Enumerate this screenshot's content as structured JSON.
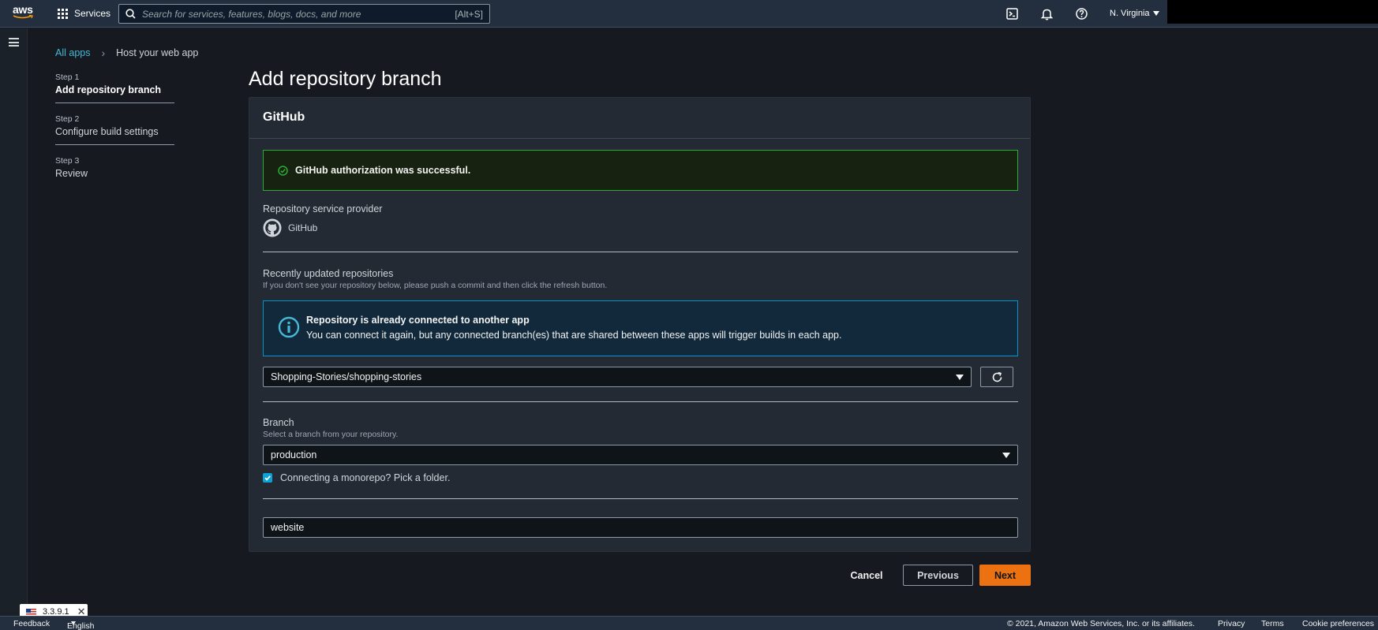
{
  "topnav": {
    "logo_text": "aws",
    "services_label": "Services",
    "search_placeholder": "Search for services, features, blogs, docs, and more",
    "search_shortcut": "[Alt+S]",
    "region": "N. Virginia"
  },
  "breadcrumb": {
    "root": "All apps",
    "current": "Host your web app"
  },
  "steps": [
    {
      "num": "Step 1",
      "title": "Add repository branch",
      "active": true
    },
    {
      "num": "Step 2",
      "title": "Configure build settings",
      "active": false
    },
    {
      "num": "Step 3",
      "title": "Review",
      "active": false
    }
  ],
  "page": {
    "title": "Add repository branch"
  },
  "card": {
    "header": "GitHub",
    "success_message": "GitHub authorization was successful.",
    "provider_label": "Repository service provider",
    "provider_name": "GitHub",
    "repos_label": "Recently updated repositories",
    "repos_desc": "If you don't see your repository below, please push a commit and then click the refresh button.",
    "info_title": "Repository is already connected to another app",
    "info_body": "You can connect it again, but any connected branch(es) that are shared between these apps will trigger builds in each app.",
    "repo_selected": "Shopping-Stories/shopping-stories",
    "branch_label": "Branch",
    "branch_desc": "Select a branch from your repository.",
    "branch_selected": "production",
    "monorepo_label": "Connecting a monorepo? Pick a folder.",
    "monorepo_checked": true,
    "folder_value": "website"
  },
  "actions": {
    "cancel": "Cancel",
    "previous": "Previous",
    "next": "Next"
  },
  "footer": {
    "feedback": "Feedback",
    "language": "English (US)",
    "copyright": "© 2021, Amazon Web Services, Inc. or its affiliates.",
    "privacy": "Privacy",
    "terms": "Terms",
    "cookies": "Cookie preferences",
    "version": "3.3.9.1"
  },
  "colors": {
    "accent_orange": "#ec7211",
    "link_blue": "#44b9d6",
    "success_green": "#29ad32",
    "info_blue": "#0095d0"
  }
}
